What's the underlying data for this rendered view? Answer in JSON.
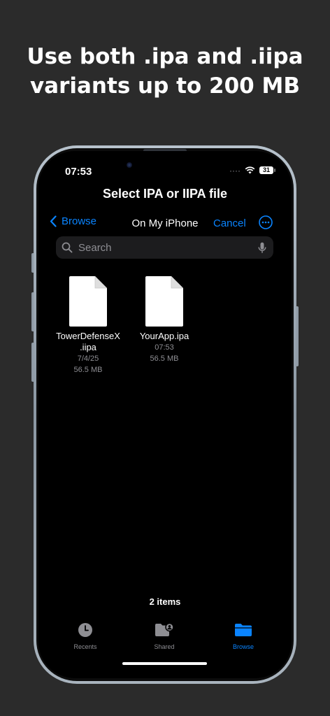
{
  "headline": {
    "line1": "Use both .ipa and .iipa",
    "line2": "variants up to 200 MB"
  },
  "status_bar": {
    "time": "07:53",
    "battery": "31"
  },
  "sheet": {
    "title": "Select IPA or IIPA file",
    "back_label": "Browse",
    "location": "On My iPhone",
    "cancel_label": "Cancel"
  },
  "search": {
    "placeholder": "Search"
  },
  "files": [
    {
      "name_line1": "TowerDefenseX",
      "name_line2": ".iipa",
      "date": "7/4/25",
      "size": "56.5 MB"
    },
    {
      "name_line1": "YourApp.ipa",
      "date": "07:53",
      "size": "56.5 MB"
    }
  ],
  "items_count": "2 items",
  "tabs": [
    {
      "label": "Recents",
      "icon": "clock-icon",
      "selected": false
    },
    {
      "label": "Shared",
      "icon": "shared-folder-icon",
      "selected": false
    },
    {
      "label": "Browse",
      "icon": "folder-icon",
      "selected": true
    }
  ],
  "colors": {
    "accent": "#0a84ff",
    "inactive_tab": "#8e8e93",
    "background": "#2b2b2b"
  }
}
